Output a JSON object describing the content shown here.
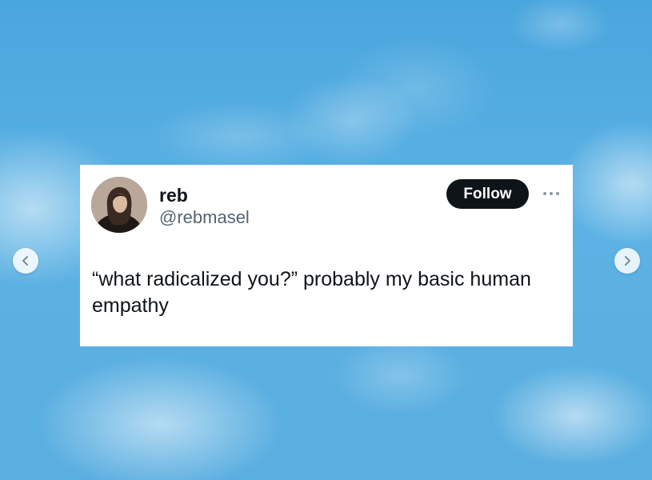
{
  "post": {
    "display_name": "reb",
    "handle": "@rebmasel",
    "follow_label": "Follow",
    "text": "“what radicalized you?” probably my basic human empathy"
  },
  "colors": {
    "background": "#55ace0",
    "card": "#ffffff",
    "follow_button": "#0f1419",
    "handle_text": "#536471"
  },
  "icons": {
    "prev": "chevron-left-icon",
    "next": "chevron-right-icon",
    "more": "more-horizontal-icon"
  }
}
